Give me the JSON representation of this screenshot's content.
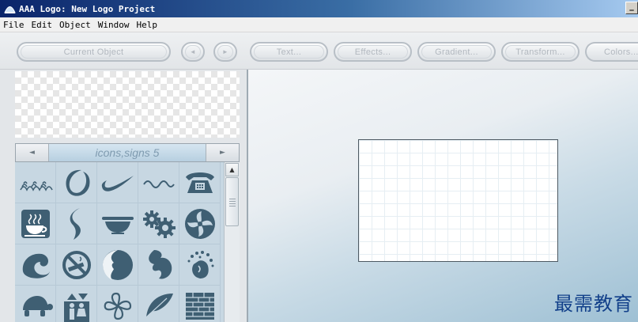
{
  "window": {
    "title": "AAA Logo: New Logo Project",
    "minimize_glyph": "_",
    "app_icon": "app-logo-icon"
  },
  "menubar": {
    "items": [
      {
        "label": "File"
      },
      {
        "label": "Edit"
      },
      {
        "label": "Object"
      },
      {
        "label": "Window"
      },
      {
        "label": "Help"
      }
    ]
  },
  "toolbar": {
    "current_object": "Current Object",
    "prev": "◄",
    "next": "►",
    "text": "Text...",
    "effects": "Effects...",
    "gradient": "Gradient...",
    "transform": "Transform...",
    "colors": "Colors..."
  },
  "library": {
    "title": "icons,signs 5",
    "prev_arrow": "◄",
    "next_arrow": "►",
    "scroll_up": "▲",
    "icons": [
      "waves-icon",
      "ring-icon",
      "swoosh-icon",
      "wave-line-icon",
      "telephone-icon",
      "hot-coffee-icon",
      "s-curve-icon",
      "bowl-icon",
      "gears-icon",
      "fan-icon",
      "spiral-wave-icon",
      "no-smoking-icon",
      "moon-face-icon",
      "globe-icon",
      "hand-print-icon",
      "turtle-icon",
      "elevator-people-icon",
      "clover-icon",
      "feather-icon",
      "brick-wall-icon"
    ]
  },
  "watermark": "最需教育",
  "colors": {
    "titlebar_start": "#0a246a",
    "icon_fill": "#3f5f73",
    "watermark": "#12408a"
  }
}
